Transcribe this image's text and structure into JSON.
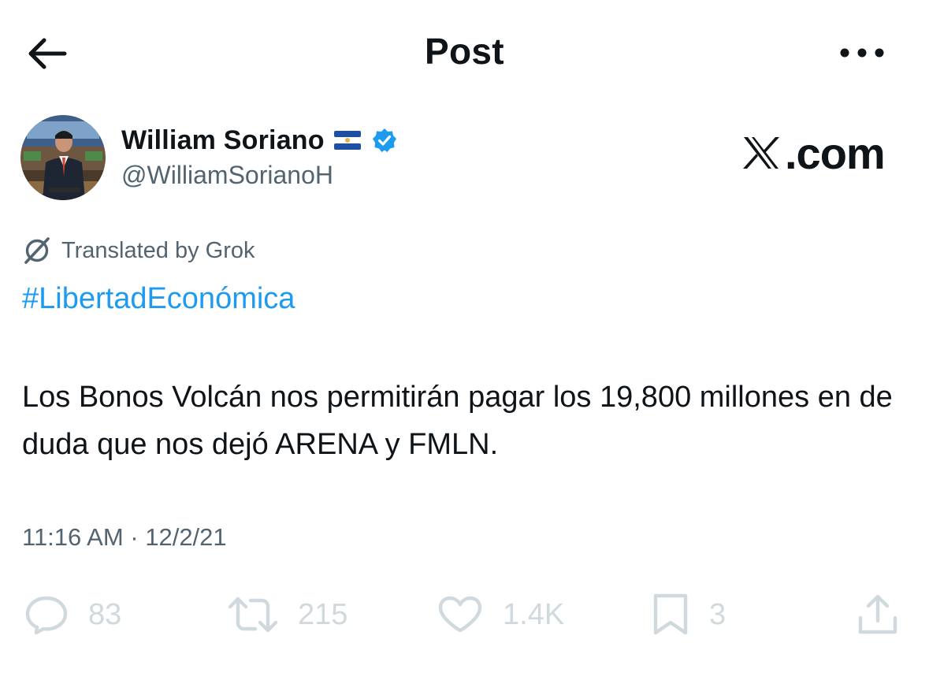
{
  "header": {
    "title": "Post",
    "back_icon": "arrow-left-icon",
    "more_icon": "more-horizontal-icon"
  },
  "author": {
    "name": "William Soriano",
    "flag": "el-salvador-flag-icon",
    "verified": "verified-badge-icon",
    "handle": "@WilliamSorianoH"
  },
  "source_logo": {
    "x_mark": "𝕏",
    "text": ".com"
  },
  "translation": {
    "icon": "grok-icon",
    "label": "Translated by Grok"
  },
  "post": {
    "hashtag": "#LibertadEconómica",
    "text": "Los Bonos Volcán nos permitirán pagar los 19,800 millones en de duda que nos dejó ARENA y FMLN.",
    "meta": "11:16 AM · 12/2/21"
  },
  "actions": {
    "replies": "83",
    "reposts": "215",
    "likes": "1.4K",
    "bookmarks": "3"
  },
  "colors": {
    "text": "#0f1419",
    "secondary": "#536471",
    "link": "#1d9bf0",
    "verified": "#1d9bf0",
    "action_faded": "#cfd9de"
  }
}
